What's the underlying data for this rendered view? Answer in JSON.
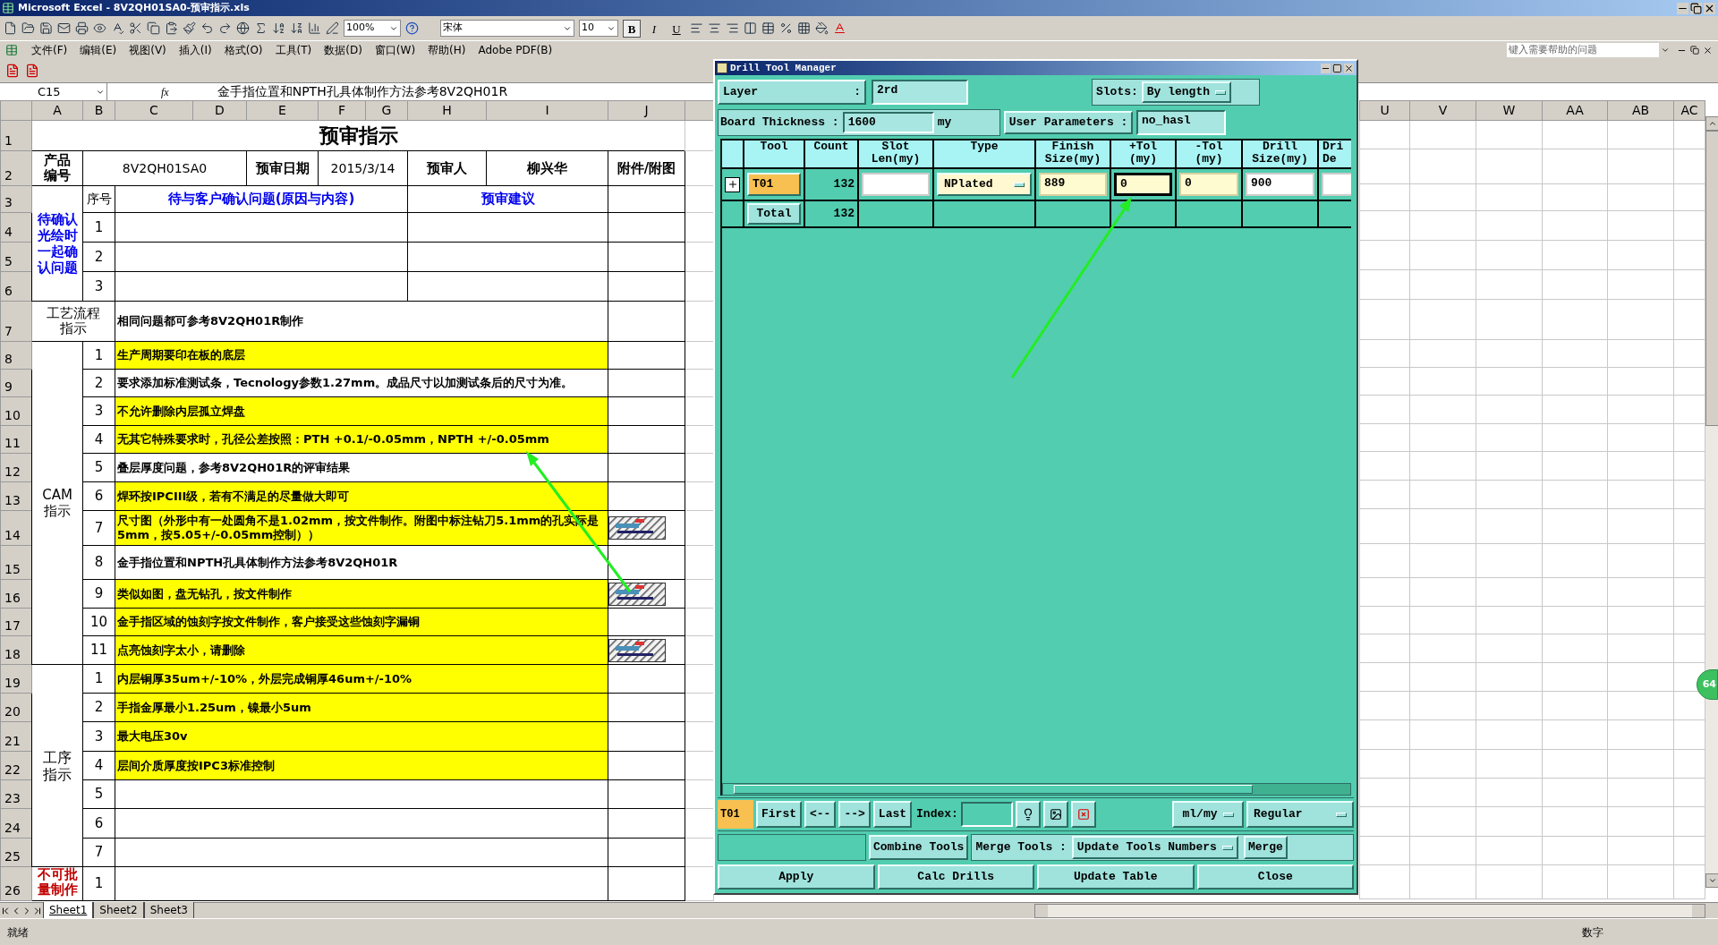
{
  "window": {
    "title": "Microsoft Excel - 8V2QH01SA0-预审指示.xls"
  },
  "toolbar": {
    "zoom": "100%",
    "font": "宋体",
    "font_size": "10",
    "format_buttons": [
      {
        "label": "B",
        "selected": true
      },
      {
        "label": "I",
        "selected": false
      },
      {
        "label": "U",
        "selected": false
      }
    ]
  },
  "menu": {
    "items": [
      "文件(F)",
      "编辑(E)",
      "视图(V)",
      "插入(I)",
      "格式(O)",
      "工具(T)",
      "数据(D)",
      "窗口(W)",
      "帮助(H)",
      "Adobe PDF(B)"
    ],
    "help_placeholder": "键入需要帮助的问题"
  },
  "formula_bar": {
    "cell": "C15",
    "fx": "fx",
    "content": "金手指位置和NPTH孔具体制作方法参考8V2QH01R"
  },
  "sheet": {
    "columns_left": [
      "A",
      "B",
      "C",
      "D",
      "E",
      "F",
      "G",
      "H",
      "I",
      "J"
    ],
    "columns_right": [
      "U",
      "V",
      "W",
      "AA",
      "AB",
      "AC"
    ],
    "row_numbers": [
      "1",
      "2",
      "3",
      "4",
      "5",
      "6",
      "7",
      "8",
      "9",
      "10",
      "11",
      "12",
      "13",
      "14",
      "15",
      "16",
      "17",
      "18",
      "19",
      "20",
      "21",
      "22",
      "23",
      "24",
      "25",
      "26"
    ],
    "title": "预审指示",
    "header": {
      "product_label": "产品编号",
      "product": "8V2QH01SA0",
      "date_label": "预审日期",
      "date": "2015/3/14",
      "reviewer_label": "预审人",
      "reviewer": "柳兴华",
      "attachment_label": "附件/附图"
    },
    "confirm": {
      "label": "待确认光绘时一起确认问题",
      "no_label": "序号",
      "issue_label": "待与客户确认问题(原因与内容)",
      "advice_label": "预审建议",
      "rows": [
        "1",
        "2",
        "3"
      ]
    },
    "process_flow": {
      "label": "工艺流程指示",
      "text": "相同问题都可参考8V2QH01R制作"
    },
    "cam": {
      "label": "CAM指示",
      "items": [
        {
          "no": "1",
          "text": "生产周期要印在板的底层",
          "highlighted": true,
          "attachment": false
        },
        {
          "no": "2",
          "text": "要求添加标准测试条，Tecnology参数1.27mm。成品尺寸以加测试条后的尺寸为准。",
          "highlighted": false,
          "attachment": false
        },
        {
          "no": "3",
          "text": "不允许删除内层孤立焊盘",
          "highlighted": true,
          "attachment": false
        },
        {
          "no": "4",
          "text": "无其它特殊要求时，孔径公差按照：PTH +0.1/-0.05mm，NPTH +/-0.05mm",
          "highlighted": true,
          "attachment": false
        },
        {
          "no": "5",
          "text": "叠层厚度问题，参考8V2QH01R的评审结果",
          "highlighted": false,
          "attachment": false
        },
        {
          "no": "6",
          "text": "焊环按IPCIII级，若有不满足的尽量做大即可",
          "highlighted": true,
          "attachment": false
        },
        {
          "no": "7",
          "text": "尺寸图（外形中有一处圆角不是1.02mm，按文件制作。附图中标注钻刀5.1mm的孔实际是5mm，按5.05+/-0.05mm控制））",
          "highlighted": true,
          "attachment": true
        },
        {
          "no": "8",
          "text": "金手指位置和NPTH孔具体制作方法参考8V2QH01R",
          "highlighted": false,
          "attachment": false
        },
        {
          "no": "9",
          "text": "类似如图，盘无钻孔，按文件制作",
          "highlighted": true,
          "attachment": true
        },
        {
          "no": "10",
          "text": "金手指区域的蚀刻字按文件制作，客户接受这些蚀刻字漏铜",
          "highlighted": true,
          "attachment": false
        },
        {
          "no": "11",
          "text": "点亮蚀刻字太小，请删除",
          "highlighted": true,
          "attachment": true
        }
      ]
    },
    "steps": {
      "label": "工序指示",
      "items": [
        {
          "no": "1",
          "text": "内层铜厚35um+/-10%，外层完成铜厚46um+/-10%",
          "highlighted": true,
          "attachment": false
        },
        {
          "no": "2",
          "text": "手指金厚最小1.25um，镍最小5um",
          "highlighted": true,
          "attachment": false
        },
        {
          "no": "3",
          "text": "最大电压30v",
          "highlighted": true,
          "attachment": false
        },
        {
          "no": "4",
          "text": "层间介质厚度按IPC3标准控制",
          "highlighted": true,
          "attachment": false
        },
        {
          "no": "5",
          "highlighted": false,
          "attachment": false
        },
        {
          "no": "6",
          "highlighted": false,
          "attachment": false
        },
        {
          "no": "7",
          "highlighted": false,
          "attachment": false
        }
      ]
    },
    "no_batch": {
      "label": "不可批量制作",
      "items": [
        {
          "no": "1",
          "highlighted": false,
          "attachment": false
        }
      ]
    }
  },
  "sheet_tabs": [
    {
      "label": "Sheet1",
      "selected": true
    },
    {
      "label": "Sheet2",
      "selected": false
    },
    {
      "label": "Sheet3",
      "selected": false
    }
  ],
  "status_bar": {
    "left": "就绪",
    "right": "数字"
  },
  "badge": "64",
  "dialog": {
    "title": "Drill Tool Manager",
    "layer": {
      "label": "Layer",
      "colon": ":",
      "value": "2rd"
    },
    "slots": {
      "label": "Slots:",
      "value": "By length"
    },
    "board_thickness": {
      "label": "Board Thickness :",
      "value": "1600",
      "unit": "my"
    },
    "user_parameters": {
      "label": "User Parameters :",
      "value": "no_hasl"
    },
    "columns": [
      "Tool",
      "Count",
      "Slot\nLen(my)",
      "Type",
      "Finish\nSize(my)",
      "+Tol\n(my)",
      "-Tol\n(my)",
      "Drill\nSize(my)",
      "Dri\nDe"
    ],
    "rows": [
      {
        "tool": "T01",
        "count": "132",
        "selected": true,
        "expanded": false,
        "fields": [
          {
            "kind": "entry"
          },
          {
            "kind": "menu",
            "value": "NPlated"
          },
          {
            "kind": "tinted",
            "value": "889",
            "focused": false
          },
          {
            "kind": "tinted",
            "value": "0",
            "focused": true
          },
          {
            "kind": "tinted",
            "value": "0",
            "focused": false
          },
          {
            "kind": "entry",
            "value": "900"
          },
          {
            "kind": "entry"
          }
        ]
      }
    ],
    "total": {
      "label": "Total",
      "count": "132"
    },
    "nav": {
      "current": "T01",
      "buttons": [
        "First",
        "<--",
        "-->",
        "Last"
      ],
      "index_label": "Index:",
      "units": "ml/my",
      "mode": "Regular"
    },
    "merge": {
      "combine": "Combine Tools",
      "label": "Merge Tools :",
      "option": "Update Tools Numbers",
      "button": "Merge"
    },
    "actions": [
      "Apply",
      "Calc Drills",
      "Update Table",
      "Close"
    ]
  }
}
